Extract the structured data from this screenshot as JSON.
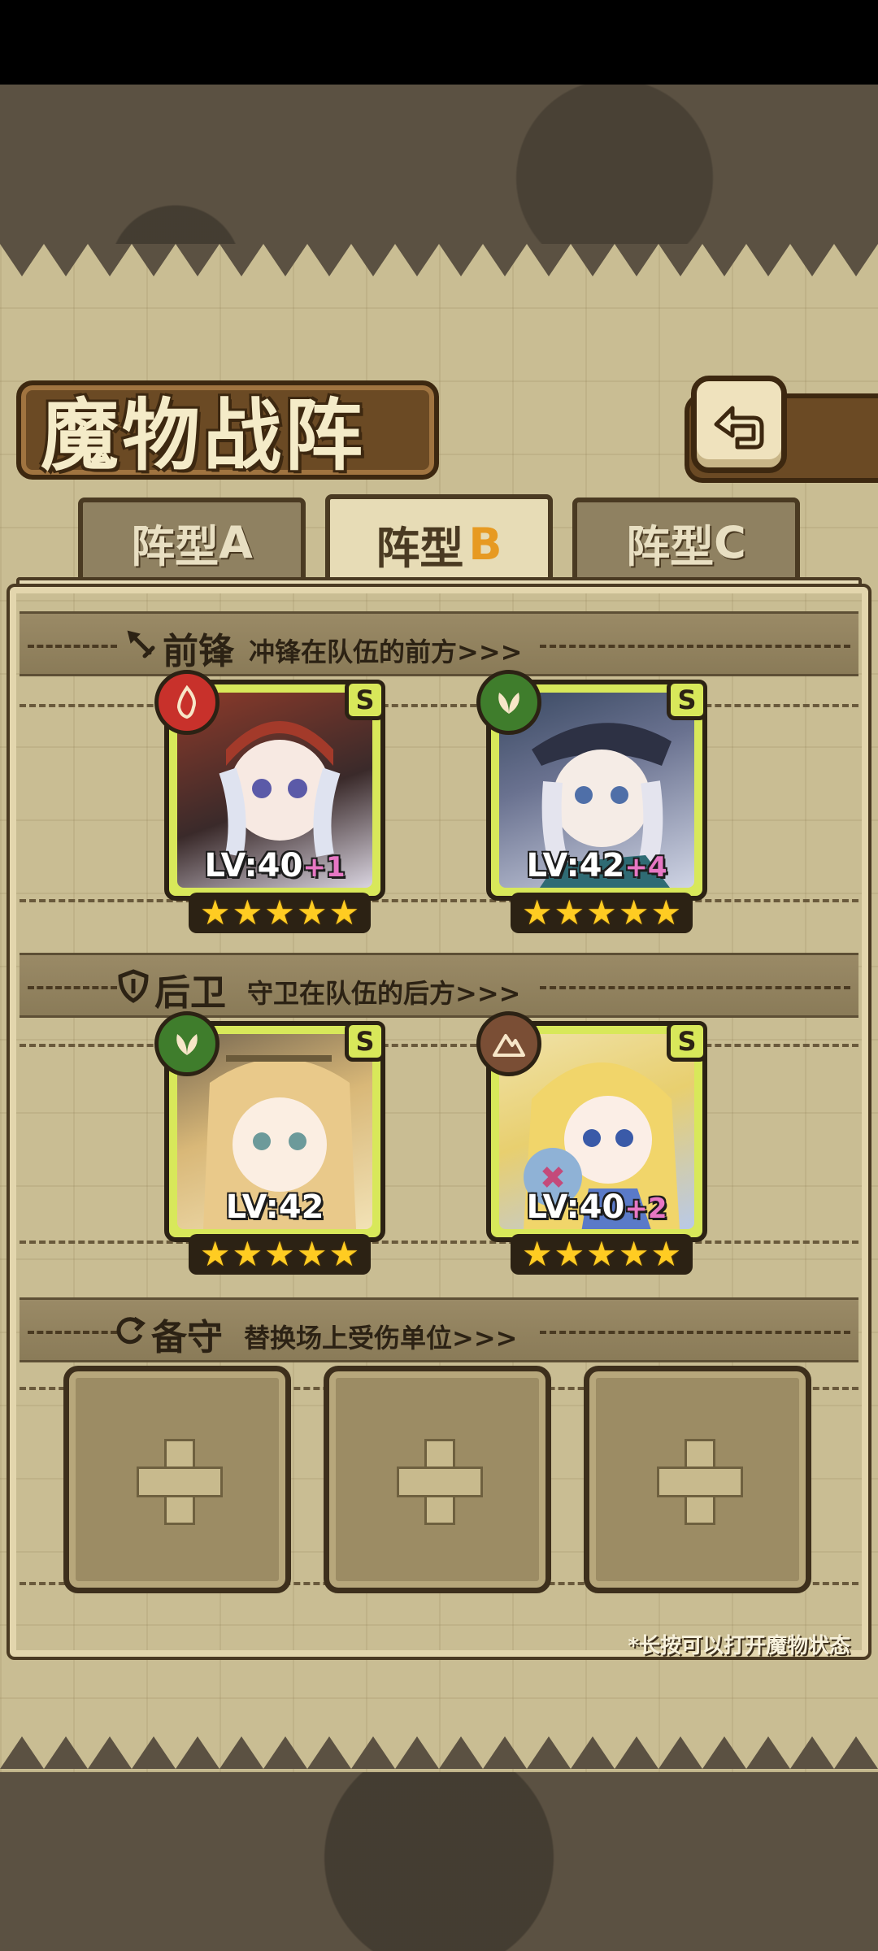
{
  "title": "魔物战阵",
  "back_icon": "return-arrow-icon",
  "tabs": [
    {
      "label": "阵型",
      "letter": "A",
      "active": false
    },
    {
      "label": "阵型",
      "letter": "B",
      "active": true
    },
    {
      "label": "阵型",
      "letter": "C",
      "active": false
    }
  ],
  "sections": {
    "front": {
      "icon": "sword-icon",
      "title": "前锋",
      "subtitle": "冲锋在队伍的前方>>>"
    },
    "rear": {
      "icon": "shield-icon",
      "title": "后卫",
      "subtitle": "守卫在队伍的后方>>>"
    },
    "reserve": {
      "icon": "swap-icon",
      "title": "备守",
      "subtitle": "替换场上受伤单位>>>"
    }
  },
  "front_units": [
    {
      "rank": "S",
      "element": "fire",
      "element_color": "#c8312b",
      "level": "LV:40",
      "bonus": "+1",
      "stars": 5,
      "portrait_color": "#8c3a2a"
    },
    {
      "rank": "S",
      "element": "leaf",
      "element_color": "#3f7d2c",
      "level": "LV:42",
      "bonus": "+4",
      "stars": 5,
      "portrait_color": "#3b4a63"
    }
  ],
  "rear_units": [
    {
      "rank": "S",
      "element": "leaf",
      "element_color": "#3f7d2c",
      "level": "LV:42",
      "bonus": "",
      "stars": 5,
      "portrait_color": "#d9b878"
    },
    {
      "rank": "S",
      "element": "earth",
      "element_color": "#7a4e35",
      "level": "LV:40",
      "bonus": "+2",
      "stars": 5,
      "portrait_color": "#e8cf6f"
    }
  ],
  "reserve_slots": 3,
  "hint": "*长按可以打开魔物状态"
}
